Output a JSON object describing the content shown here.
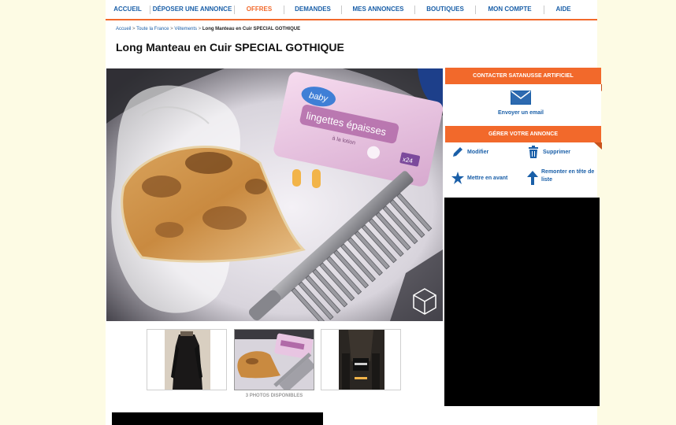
{
  "nav": {
    "items": [
      {
        "label": "ACCUEIL",
        "active": false
      },
      {
        "label": "DÉPOSER UNE ANNONCE",
        "active": false
      },
      {
        "label": "OFFRES",
        "active": true
      },
      {
        "label": "DEMANDES",
        "active": false
      },
      {
        "label": "MES ANNONCES",
        "active": false
      },
      {
        "label": "BOUTIQUES",
        "active": false
      },
      {
        "label": "MON COMPTE",
        "active": false
      },
      {
        "label": "AIDE",
        "active": false
      }
    ]
  },
  "breadcrumb": {
    "home": "Accueil",
    "region": "Toute la France",
    "category": "Vêtements",
    "current": "Long Manteau en Cuir SPECIAL GOTHIQUE",
    "separator": ">"
  },
  "listing": {
    "title": "Long Manteau en Cuir SPECIAL GOTHIQUE",
    "photos_count_label": "3 PHOTOS DISPONIBLES",
    "wipes_brand": "baby",
    "wipes_text": "lingettes épaisses",
    "wipes_sub": "à la lotion",
    "wipes_count": "x24"
  },
  "sidebar": {
    "contact_header": "CONTACTER SATANUSSE ARTIFICIEL",
    "email_label": "Envoyer un email",
    "manage_header": "GÉRER VOTRE ANNONCE",
    "actions": {
      "modify": "Modifier",
      "delete": "Supprimer",
      "feature": "Mettre en avant",
      "bump": "Remonter en tête de liste"
    }
  },
  "colors": {
    "accent": "#f2692b",
    "link": "#1a5fa8",
    "background": "#fdfbe4"
  }
}
